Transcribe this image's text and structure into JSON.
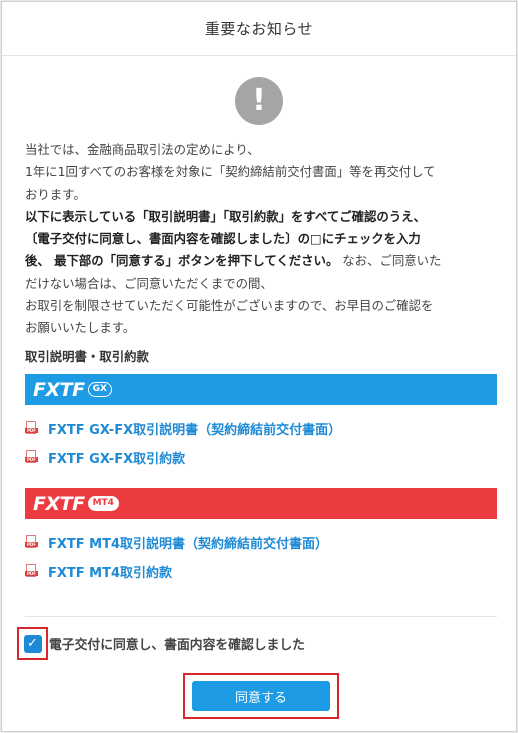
{
  "dialog": {
    "title": "重要なお知らせ"
  },
  "notice": {
    "line1": "当社では、金融商品取引法の定めにより、",
    "line2": "1年に1回すべてのお客様を対象に「契約締結前交付書面」等を再交付して",
    "line3": "おります。",
    "bold1": "以下に表示している「取引説明書」「取引約款」をすべてご確認のうえ、",
    "bold2": "〔電子交付に同意し、書面内容を確認しました〕の□にチェックを入力",
    "bold3": "後、 最下部の「同意する」ボタンを押下してください。",
    "rest3": " なお、ご同意いた",
    "line4": "だけない場合は、ご同意いただくまでの間、",
    "line5": "お取引を制限させていただく可能性がございますので、お早目のご確認を",
    "line6": "お願いいたします。"
  },
  "section_label": "取引説明書・取引約款",
  "gx": {
    "logo_text": "FXTF",
    "badge": "GX",
    "links": [
      "FXTF GX-FX取引説明書（契約締結前交付書面）",
      "FXTF GX-FX取引約款"
    ]
  },
  "mt4": {
    "logo_text": "FXTF",
    "badge": "MT4",
    "links": [
      "FXTF MT4取引説明書（契約締結前交付書面）",
      "FXTF MT4取引約款"
    ]
  },
  "pdf_tag": "PDF",
  "agree": {
    "checked": true,
    "label": "電子交付に同意し、書面内容を確認しました",
    "button": "同意する"
  },
  "colors": {
    "gx_bar": "#1e9be5",
    "mt4_bar": "#ec3b41",
    "link": "#1e8ad6",
    "highlight": "#d9262c"
  }
}
